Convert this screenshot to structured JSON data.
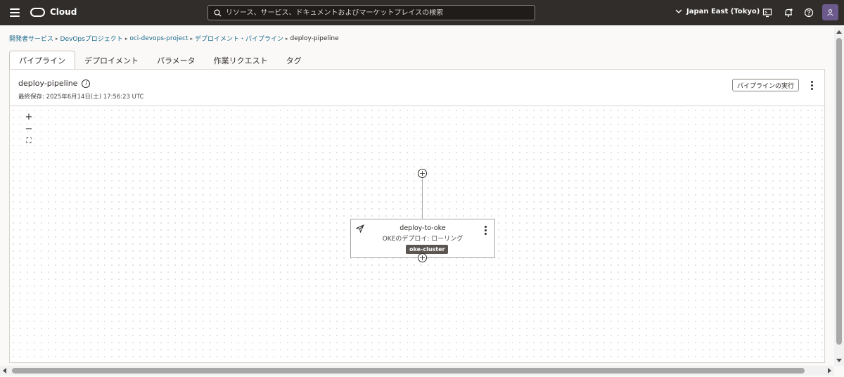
{
  "header": {
    "brand": "Cloud",
    "search_placeholder": "リソース、サービス、ドキュメントおよびマーケットプレイスの検索",
    "region": "Japan East (Tokyo)"
  },
  "breadcrumb": {
    "items": [
      "開発者サービス",
      "DevOpsプロジェクト",
      "oci-devops-project",
      "デプロイメント・パイプライン"
    ],
    "current": "deploy-pipeline",
    "separator": "▸"
  },
  "tabs": [
    {
      "label": "パイプライン",
      "active": true
    },
    {
      "label": "デプロイメント",
      "active": false
    },
    {
      "label": "パラメータ",
      "active": false
    },
    {
      "label": "作業リクエスト",
      "active": false
    },
    {
      "label": "タグ",
      "active": false
    }
  ],
  "pipeline": {
    "title": "deploy-pipeline",
    "info_glyph": "i",
    "last_saved": "最終保存: 2025年6月14日(土) 17:56:23 UTC",
    "run_button": "パイプラインの実行"
  },
  "zoom": {
    "in": "+",
    "out": "−",
    "fit": "⛶"
  },
  "stage": {
    "name": "deploy-to-oke",
    "type": "OKEのデプロイ: ローリング",
    "badge": "oke-cluster",
    "add_glyph": "+"
  },
  "colors": {
    "topbar": "#312d2a",
    "link": "#1a6a8a",
    "avatar": "#6c5a8c",
    "badge": "#5b5652"
  }
}
